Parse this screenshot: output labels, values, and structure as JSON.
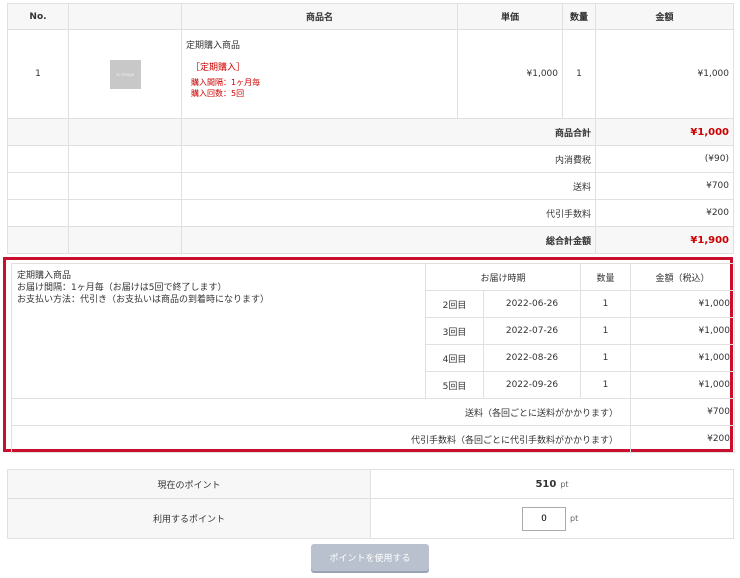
{
  "order_table": {
    "headers": {
      "no": "No.",
      "image": "",
      "name": "商品名",
      "unit_price": "単価",
      "quantity": "数量",
      "amount": "金額"
    },
    "item": {
      "no": "1",
      "thumb_text": "no image",
      "name": "定期購入商品",
      "tag": "［定期購入］",
      "interval": "購入間隔：1ヶ月毎",
      "count": "購入回数：5回",
      "unit_price": "¥1,000",
      "quantity": "1",
      "amount": "¥1,000"
    },
    "summary": [
      {
        "label": "商品合計",
        "value": "¥1,000"
      },
      {
        "label": "内消費税",
        "value": "(¥90)"
      },
      {
        "label": "送料",
        "value": "¥700"
      },
      {
        "label": "代引手数料",
        "value": "¥200"
      },
      {
        "label": "総合計金額",
        "value": "¥1,900"
      }
    ]
  },
  "subscription": {
    "info": {
      "title": "定期購入商品",
      "delivery": "お届け間隔：1ヶ月毎（お届けは5回で終了します）",
      "payment": "お支払い方法：代引き（お支払いは商品の到着時になります）"
    },
    "headers": {
      "period": "お届け時期",
      "quantity": "数量",
      "amount": "金額（税込）"
    },
    "rows": [
      {
        "nth": "2回目",
        "date": "2022-06-26",
        "qty": "1",
        "amount": "¥1,000"
      },
      {
        "nth": "3回目",
        "date": "2022-07-26",
        "qty": "1",
        "amount": "¥1,000"
      },
      {
        "nth": "4回目",
        "date": "2022-08-26",
        "qty": "1",
        "amount": "¥1,000"
      },
      {
        "nth": "5回目",
        "date": "2022-09-26",
        "qty": "1",
        "amount": "¥1,000"
      }
    ],
    "shipping": {
      "label": "送料（各回ごとに送料がかかります）",
      "value": "¥700"
    },
    "cod_fee": {
      "label": "代引手数料（各回ごとに代引手数料がかかります）",
      "value": "¥200"
    }
  },
  "points": {
    "current_label": "現在のポイント",
    "current_value": "510",
    "unit": "pt",
    "use_label": "利用するポイント",
    "use_value": "0"
  },
  "use_points_button": "ポイントを使用する",
  "colors": {
    "accent_red": "#c8102e",
    "price_red": "#cc0000",
    "button": "#b9c1cf"
  }
}
